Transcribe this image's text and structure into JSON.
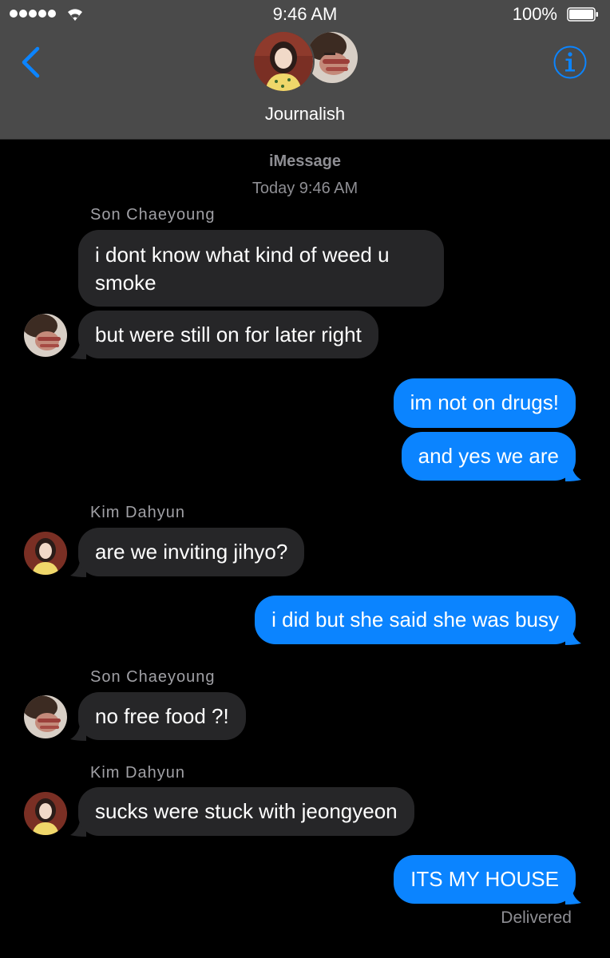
{
  "status_bar": {
    "time": "9:46 AM",
    "battery": "100%"
  },
  "nav": {
    "group_name": "Journalish",
    "back_icon": "chevron-left-icon",
    "info_icon": "info-circle-icon"
  },
  "chat": {
    "service": "iMessage",
    "timestamp": "Today 9:46 AM",
    "senders": {
      "s1": "Son Chaeyoung",
      "s2": "Kim Dahyun",
      "s3": "Son Chaeyoung",
      "s4": "Kim Dahyun"
    },
    "messages": {
      "m1": "i dont know what kind of weed u smoke",
      "m2": "but were still on for later right",
      "m3": "im not on drugs!",
      "m4": "and yes we are",
      "m5": "are we inviting jihyo?",
      "m6": "i did but she said she was busy",
      "m7": "no free food ?!",
      "m8": "sucks were stuck with jeongyeon",
      "m9": "ITS MY HOUSE"
    },
    "status": "Delivered"
  },
  "colors": {
    "header_bg": "#4a4a4a",
    "incoming_bubble": "#262628",
    "outgoing_bubble": "#0b84ff",
    "accent": "#0b84ff"
  }
}
